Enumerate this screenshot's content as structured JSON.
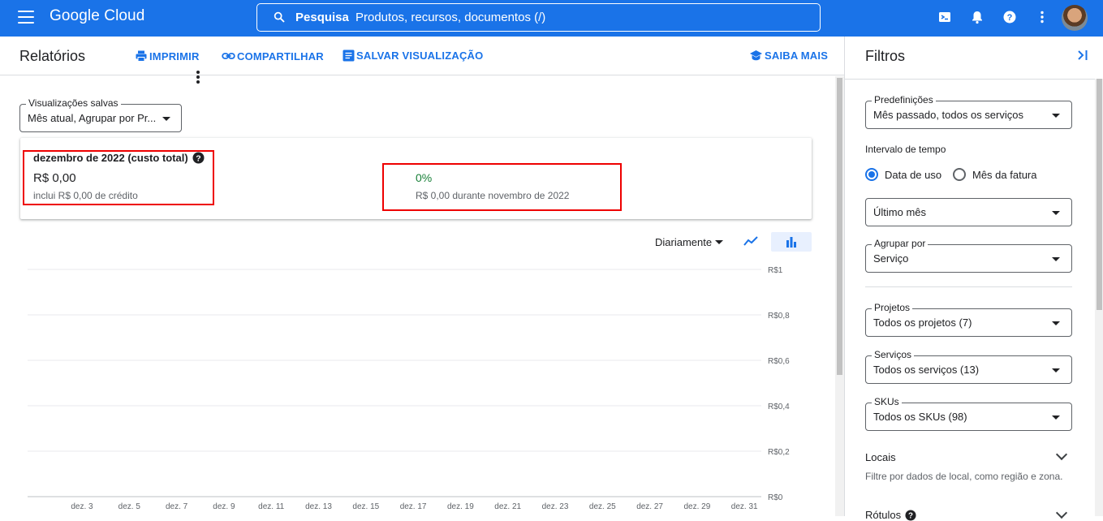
{
  "header": {
    "logo": "Google Cloud",
    "search_label": "Pesquisa",
    "search_placeholder": "Produtos, recursos, documentos (/)"
  },
  "toolbar": {
    "title": "Relatórios",
    "print": "IMPRIMIR",
    "share": "COMPARTILHAR",
    "save_view": "SALVAR VISUALIZAÇÃO",
    "learn_more": "SAIBA MAIS"
  },
  "saved_views": {
    "legend": "Visualizações salvas",
    "value": "Mês atual, Agrupar por Pr..."
  },
  "summary": {
    "title": "dezembro de 2022 (custo total)",
    "total": "R$ 0,00",
    "credit_note": "inclui R$ 0,00 de crédito",
    "change": "0%",
    "compare_note": "R$ 0,00 durante novembro de 2022",
    "change_color": "#188038"
  },
  "chart_controls": {
    "granularity": "Diariamente"
  },
  "chart_data": {
    "type": "bar",
    "ylabel": "",
    "xlabel": "",
    "ylim": [
      0,
      1
    ],
    "y_ticks": [
      "R$1",
      "R$0,8",
      "R$0,6",
      "R$0,4",
      "R$0,2",
      "R$0"
    ],
    "y_tick_values": [
      1,
      0.8,
      0.6,
      0.4,
      0.2,
      0
    ],
    "categories": [
      "dez. 3",
      "dez. 5",
      "dez. 7",
      "dez. 9",
      "dez. 11",
      "dez. 13",
      "dez. 15",
      "dez. 17",
      "dez. 19",
      "dez. 21",
      "dez. 23",
      "dez. 25",
      "dez. 27",
      "dez. 29",
      "dez. 31"
    ],
    "values": [
      0,
      0,
      0,
      0,
      0,
      0,
      0,
      0,
      0,
      0,
      0,
      0,
      0,
      0,
      0
    ],
    "grid": true
  },
  "filters": {
    "title": "Filtros",
    "presets_legend": "Predefinições",
    "presets_value": "Mês passado, todos os serviços",
    "time_range_label": "Intervalo de tempo",
    "radio_usage": "Data de uso",
    "radio_invoice": "Mês da fatura",
    "period_value": "Último mês",
    "group_legend": "Agrupar por",
    "group_value": "Serviço",
    "projects_legend": "Projetos",
    "projects_value": "Todos os projetos (7)",
    "services_legend": "Serviços",
    "services_value": "Todos os serviços (13)",
    "skus_legend": "SKUs",
    "skus_value": "Todos os SKUs (98)",
    "locations_label": "Locais",
    "locations_desc": "Filtre por dados de local, como região e zona.",
    "labels_label": "Rótulos"
  },
  "colors": {
    "brand": "#1a73e8",
    "highlight_box": "#e00000"
  }
}
